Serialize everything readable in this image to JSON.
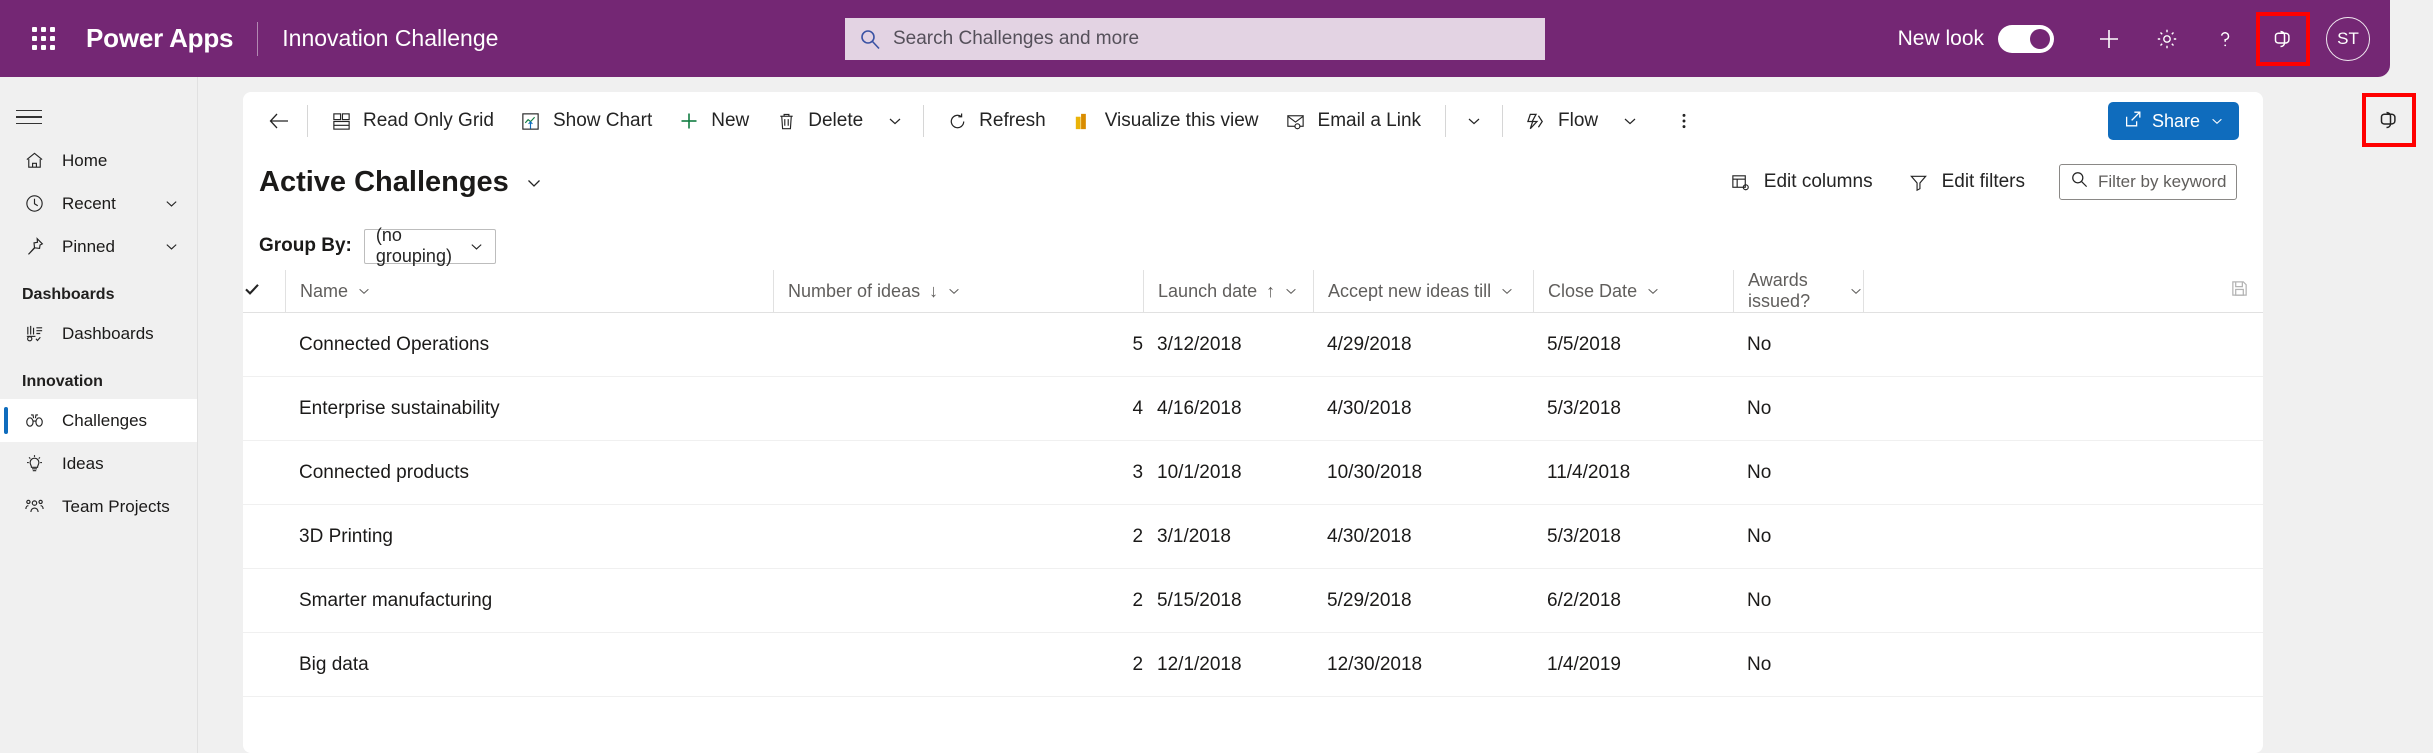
{
  "header": {
    "waffle_icon": "app-launcher-icon",
    "brand": "Power Apps",
    "app_name": "Innovation Challenge",
    "search": {
      "icon": "search-icon",
      "placeholder": "Search Challenges and more",
      "value": ""
    },
    "new_look_label": "New look",
    "new_look_on": true,
    "icons": [
      {
        "name": "plus-icon",
        "glyph": "+"
      },
      {
        "name": "gear-icon",
        "glyph": "gear"
      },
      {
        "name": "help-icon",
        "glyph": "?"
      },
      {
        "name": "copilot-icon",
        "glyph": "copilot",
        "highlighted": true
      }
    ],
    "avatar_initials": "ST",
    "background_color": "#742774"
  },
  "sidebar": {
    "hamburger_icon": "hamburger-menu-icon",
    "items": [
      {
        "label": "Home",
        "icon": "home-icon",
        "has_chevron": false,
        "selected": false
      },
      {
        "label": "Recent",
        "icon": "clock-icon",
        "has_chevron": true,
        "selected": false
      },
      {
        "label": "Pinned",
        "icon": "pin-icon",
        "has_chevron": true,
        "selected": false
      }
    ],
    "groups": [
      {
        "label": "Dashboards",
        "items": [
          {
            "label": "Dashboards",
            "icon": "dashboard-icon",
            "selected": false
          }
        ]
      },
      {
        "label": "Innovation",
        "items": [
          {
            "label": "Challenges",
            "icon": "binoculars-icon",
            "selected": true
          },
          {
            "label": "Ideas",
            "icon": "lightbulb-icon",
            "selected": false
          },
          {
            "label": "Team Projects",
            "icon": "team-icon",
            "selected": false
          }
        ]
      }
    ]
  },
  "command_bar": {
    "back_icon": "back-arrow-icon",
    "buttons": [
      {
        "label": "Read Only Grid",
        "icon": "grid-icon"
      },
      {
        "label": "Show Chart",
        "icon": "chart-icon"
      },
      {
        "label": "New",
        "icon": "plus-icon"
      },
      {
        "label": "Delete",
        "icon": "trash-icon"
      },
      {
        "label": "Refresh",
        "icon": "refresh-icon"
      },
      {
        "label": "Visualize this view",
        "icon": "powerbi-icon"
      },
      {
        "label": "Email a Link",
        "icon": "email-icon"
      },
      {
        "label": "Flow",
        "icon": "flow-icon"
      }
    ],
    "overflow_icon": "more-vertical-icon",
    "share_label": "Share",
    "share_icon": "share-icon",
    "share_color": "#0f6cbd"
  },
  "copilot_rail": {
    "icon": "copilot-icon",
    "highlighted": true
  },
  "view": {
    "title": "Active Challenges",
    "title_chevron_icon": "chevron-down-icon",
    "edit_columns_label": "Edit columns",
    "edit_columns_icon": "edit-columns-icon",
    "edit_filters_label": "Edit filters",
    "edit_filters_icon": "filter-icon",
    "filter_search": {
      "icon": "search-icon",
      "placeholder": "Filter by keyword",
      "value": ""
    },
    "group_by_label": "Group By:",
    "group_by_value": "(no grouping)",
    "save_icon": "save-icon"
  },
  "table": {
    "select_all_icon": "checkmark-icon",
    "columns": [
      {
        "label": "Name",
        "sort": "",
        "align": "left"
      },
      {
        "label": "Number of ideas",
        "sort": "desc",
        "align": "right"
      },
      {
        "label": "Launch date",
        "sort": "asc",
        "align": "left"
      },
      {
        "label": "Accept new ideas till",
        "sort": "",
        "align": "left"
      },
      {
        "label": "Close Date",
        "sort": "",
        "align": "left"
      },
      {
        "label": "Awards issued?",
        "sort": "",
        "align": "left"
      },
      {
        "label": "",
        "sort": "",
        "align": "left"
      }
    ],
    "rows": [
      {
        "name": "Connected Operations",
        "ideas": "5",
        "launch": "3/12/2018",
        "accept": "4/29/2018",
        "close": "5/5/2018",
        "awards": "No"
      },
      {
        "name": "Enterprise sustainability",
        "ideas": "4",
        "launch": "4/16/2018",
        "accept": "4/30/2018",
        "close": "5/3/2018",
        "awards": "No"
      },
      {
        "name": "Connected products",
        "ideas": "3",
        "launch": "10/1/2018",
        "accept": "10/30/2018",
        "close": "11/4/2018",
        "awards": "No"
      },
      {
        "name": "3D Printing",
        "ideas": "2",
        "launch": "3/1/2018",
        "accept": "4/30/2018",
        "close": "5/3/2018",
        "awards": "No"
      },
      {
        "name": "Smarter manufacturing",
        "ideas": "2",
        "launch": "5/15/2018",
        "accept": "5/29/2018",
        "close": "6/2/2018",
        "awards": "No"
      },
      {
        "name": "Big data",
        "ideas": "2",
        "launch": "12/1/2018",
        "accept": "12/30/2018",
        "close": "1/4/2019",
        "awards": "No"
      }
    ]
  }
}
